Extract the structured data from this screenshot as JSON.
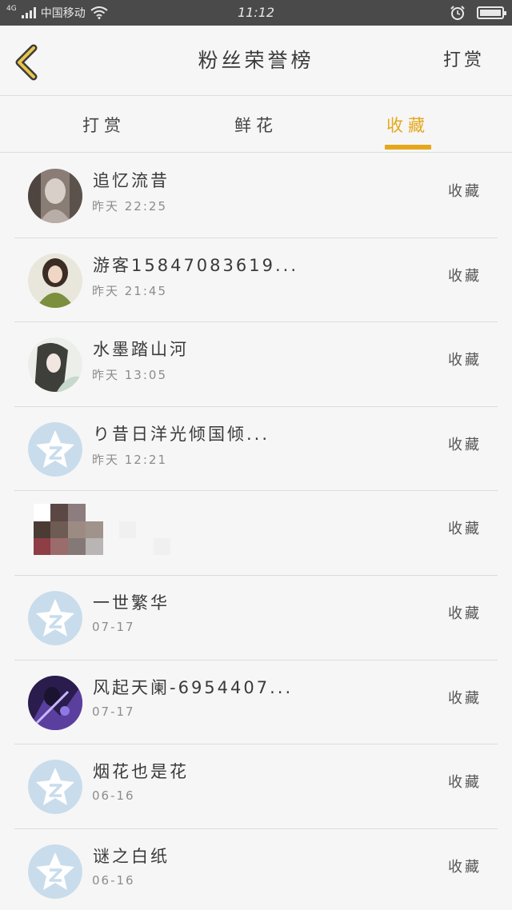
{
  "status_bar": {
    "network": "4G",
    "carrier": "中国移动",
    "time": "11:12"
  },
  "nav": {
    "title": "粉丝荣誉榜",
    "action": "打赏"
  },
  "tabs": [
    {
      "label": "打赏",
      "active": false
    },
    {
      "label": "鲜花",
      "active": false
    },
    {
      "label": "收藏",
      "active": true
    }
  ],
  "colors": {
    "accent": "#e5a81c",
    "default_avatar": "#c9dceb"
  },
  "fans": [
    {
      "name": "追忆流昔",
      "time": "昨天 22:25",
      "status": "收藏",
      "avatar": "photo-sketch"
    },
    {
      "name": "游客15847083619...",
      "time": "昨天 21:45",
      "status": "收藏",
      "avatar": "photo-girl"
    },
    {
      "name": "水墨踏山河",
      "time": "昨天 13:05",
      "status": "收藏",
      "avatar": "photo-anime"
    },
    {
      "name": "り昔日洋光倾国倾...",
      "time": "昨天 12:21",
      "status": "收藏",
      "avatar": "default-qq"
    },
    {
      "name": "",
      "time": "",
      "status": "收藏",
      "avatar": "pixelated"
    },
    {
      "name": "一世繁华",
      "time": "07-17",
      "status": "收藏",
      "avatar": "default-qq"
    },
    {
      "name": "风起天阑-6954407...",
      "time": "07-17",
      "status": "收藏",
      "avatar": "photo-purple"
    },
    {
      "name": "烟花也是花",
      "time": "06-16",
      "status": "收藏",
      "avatar": "default-qq"
    },
    {
      "name": "谜之白纸",
      "time": "06-16",
      "status": "收藏",
      "avatar": "default-qq"
    }
  ]
}
